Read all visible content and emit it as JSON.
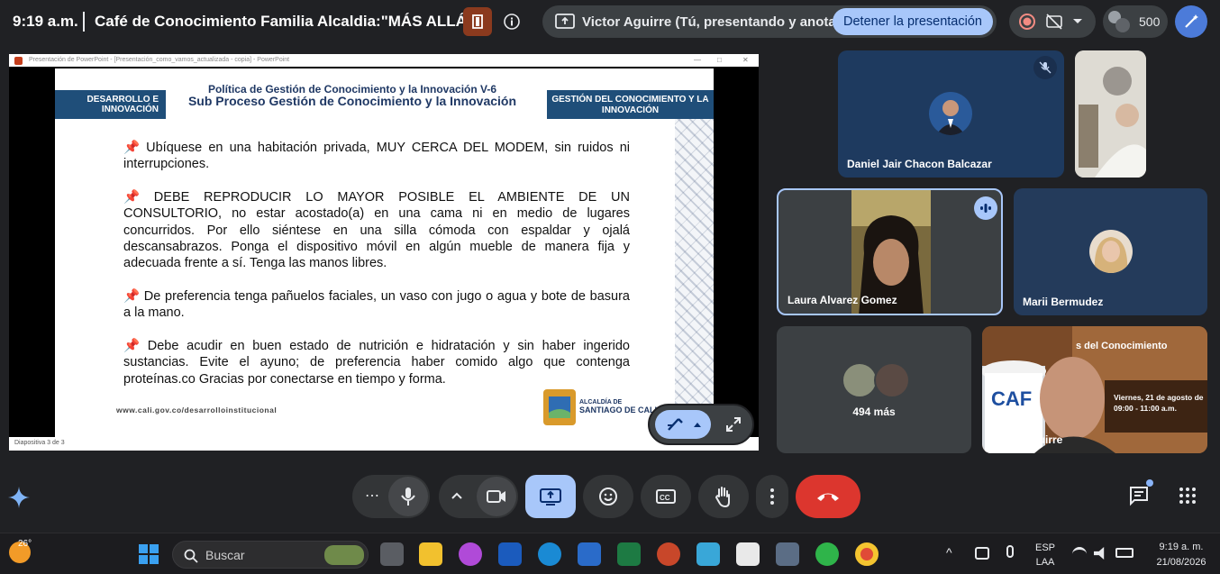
{
  "topbar": {
    "time": "9:19 a.m.",
    "meeting_title": "Café de Conocimiento Familia Alcaldia:\"MÁS ALLÁ ...",
    "presenting_text": "Victor Aguirre (Tú, presentando y anota...",
    "stop_presenting_label": "Detener la presentación",
    "participant_count": "500"
  },
  "slide": {
    "window_title": "Presentación de PowerPoint - [Presentación_como_vamos_actualizada - copia] - PowerPoint",
    "box_left": "DESARROLLO E INNOVACIÓN",
    "box_right": "GESTIÓN DEL CONOCIMIENTO Y LA INNOVACIÓN",
    "title1": "Política de Gestión de Conocimiento y la Innovación V-6",
    "title2": "Sub Proceso Gestión de Conocimiento y la Innovación",
    "paragraphs": [
      "Ubíquese en una habitación privada, MUY CERCA DEL MODEM, sin ruidos ni interrupciones.",
      "DEBE REPRODUCIR LO MAYOR POSIBLE EL AMBIENTE DE UN CONSULTORIO, no estar acostado(a) en una cama ni en medio de lugares concurridos. Por ello siéntese en una silla cómoda con espaldar y ojalá descansabrazos. Ponga el dispositivo móvil en algún mueble de manera fija y adecuada frente a sí. Tenga las manos libres.",
      "De preferencia tenga pañuelos faciales, un vaso con jugo o agua y bote de basura a la mano.",
      "Debe acudir en buen estado de nutrición e hidratación y sin haber ingerido sustancias. Evite el ayuno; de preferencia haber comido algo que contenga proteínas.co Gracias por conectarse en tiempo y forma."
    ],
    "url": "www.cali.gov.co/desarrolloinstitucional",
    "logo_line1": "ALCALDÍA DE",
    "logo_line2": "SANTIAGO DE CALI",
    "status": "Diapositiva 3 de 3"
  },
  "participants": {
    "daniel": "Daniel Jair Chacon Balcazar",
    "laura": "Laura Alvarez Gomez",
    "marii": "Marii Bermudez",
    "more": "494 más",
    "victor": "Victor Aguirre",
    "victor_bg_title": "s del Conocimiento",
    "victor_bg_line": "Viernes, 21 de agosto de",
    "victor_bg_time": "09:00 - 11:00 a.m."
  },
  "taskbar": {
    "weather": "26°",
    "search_placeholder": "Buscar",
    "lang1": "ESP",
    "lang2": "LAA",
    "clock_time": "9:19 a. m.",
    "clock_date": "21/08/2026"
  },
  "colors": {
    "accent": "#a8c7fa",
    "end_call": "#dc362e",
    "slide_navy": "#1f4e79"
  }
}
